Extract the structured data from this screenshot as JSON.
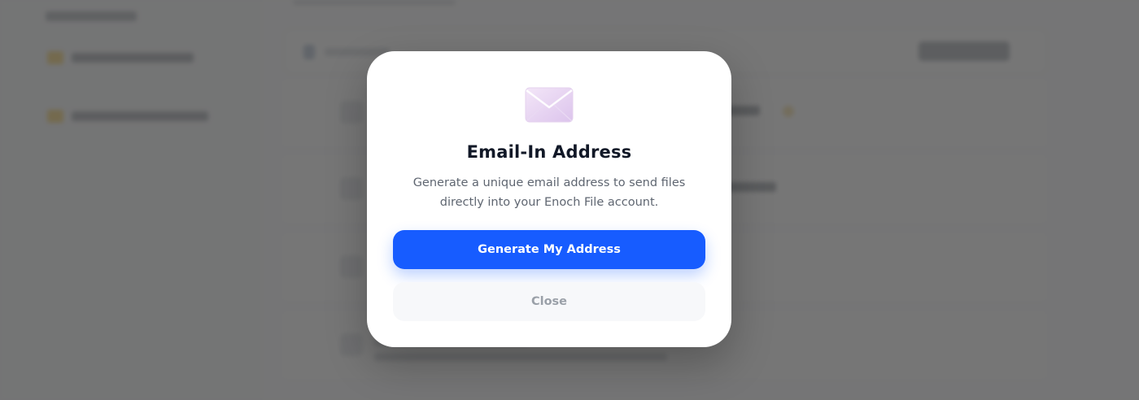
{
  "modal": {
    "icon": "envelope-icon",
    "title": "Email-In Address",
    "description": "Generate a unique email address to send files directly into your Enoch File account.",
    "primary_button_label": "Generate My Address",
    "secondary_button_label": "Close"
  },
  "colors": {
    "primary": "#175cff",
    "overlay": "#505050",
    "title_text": "#111827",
    "body_text": "#5f6671",
    "secondary_text": "#9aa0a8",
    "envelope": "#e8d6f2"
  }
}
